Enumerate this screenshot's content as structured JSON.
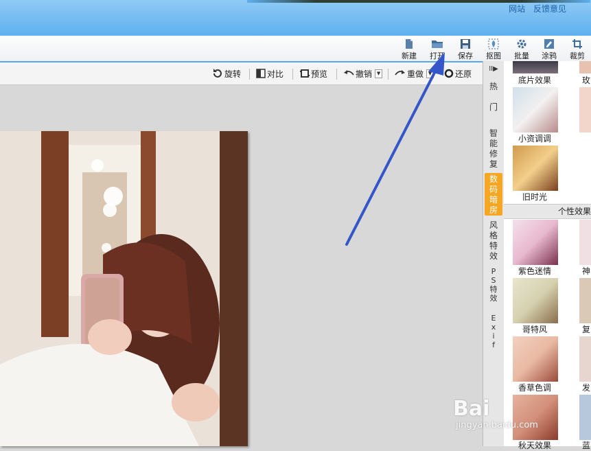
{
  "title_links": {
    "site": "网站",
    "feedback": "反馈意见"
  },
  "toolbar": {
    "new": "新建",
    "open": "打开",
    "save": "保存",
    "cutout": "抠图",
    "batch": "批量",
    "doodle": "涂鸦",
    "crop": "裁剪"
  },
  "subtoolbar": {
    "rotate": "旋转",
    "compare": "对比",
    "preview": "预览",
    "undo": "撤销",
    "redo": "重做",
    "restore": "还原"
  },
  "side_tabs": {
    "collapse": "II▶",
    "hot": "热\n\n门",
    "smart_fix": "智\n能\n修\n复",
    "digital_darkroom": "数\n码\n暗\n房",
    "style_effects": "风\n格\n特\n效",
    "ps_effects": "P\nS\n特\n效",
    "exif": "E\nx\ni\nf"
  },
  "effects": {
    "items_top": [
      {
        "label": "底片效果",
        "right_partial": "玫"
      },
      {
        "label": "小资调调"
      },
      {
        "label": "旧时光"
      }
    ],
    "section_title": "个性效果",
    "items_bottom": [
      {
        "label": "紫色迷情",
        "right_partial": "神"
      },
      {
        "label": "哥特风",
        "right_partial": "复"
      },
      {
        "label": "香草色调",
        "right_partial": "发"
      },
      {
        "label": "秋天效果",
        "right_partial": "蓝"
      }
    ]
  },
  "watermark": {
    "brand": "Bai",
    "sub": "jingyan.baidu.com"
  },
  "colors": {
    "accent": "#58a9e8",
    "active_tab": "#f5a623",
    "arrow": "#3556c8"
  }
}
